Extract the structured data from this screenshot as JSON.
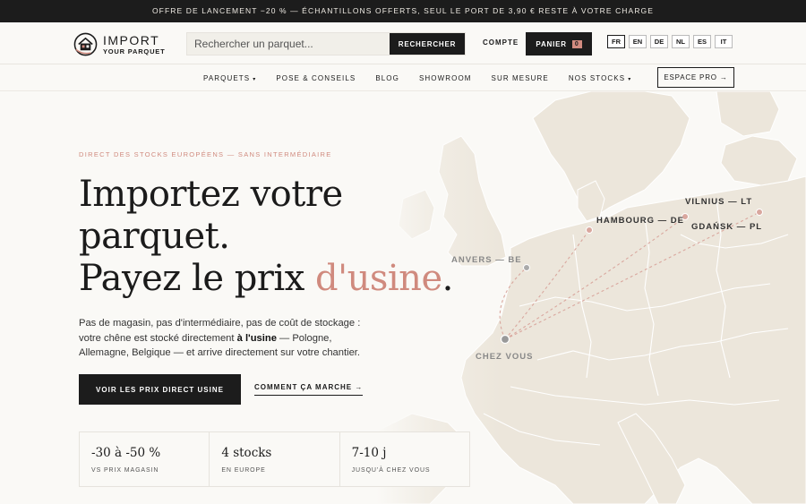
{
  "topbar": {
    "text": "OFFRE DE LANCEMENT −20 % — ÉCHANTILLONS OFFERTS, SEUL LE PORT DE 3,90 € RESTE À VOTRE CHARGE"
  },
  "header": {
    "logo_main": "IMPORT",
    "logo_sub": "YOUR PARQUET",
    "search_placeholder": "Rechercher un parquet...",
    "search_button": "RECHERCHER",
    "account": "COMPTE",
    "cart_label": "PANIER",
    "cart_count": "0",
    "languages": [
      "FR",
      "EN",
      "DE",
      "NL",
      "ES",
      "IT"
    ],
    "active_language": "FR"
  },
  "nav": {
    "items": [
      {
        "label": "PARQUETS",
        "caret": "▾"
      },
      {
        "label": "POSE & CONSEILS",
        "caret": ""
      },
      {
        "label": "BLOG",
        "caret": ""
      },
      {
        "label": "SHOWROOM",
        "caret": ""
      },
      {
        "label": "SUR MESURE",
        "caret": ""
      },
      {
        "label": "NOS STOCKS",
        "caret": "▾"
      }
    ],
    "pro_button": "ESPACE PRO →"
  },
  "hero": {
    "eyebrow": "DIRECT DES STOCKS EUROPÉENS — SANS INTERMÉDIAIRE",
    "title_line1": "Importez votre",
    "title_line2": "parquet.",
    "title_line3_pre": "Payez le prix ",
    "title_line3_accent": "d'usine",
    "title_line3_post": ".",
    "lead_pre": "Pas de magasin, pas d'intermédiaire, pas de coût de stockage : votre chêne est stocké directement ",
    "lead_strong": "à l'usine",
    "lead_post": " — Pologne, Allemagne, Belgique — et arrive directement sur votre chantier.",
    "cta_primary": "VOIR LES PRIX DIRECT USINE",
    "cta_link": "COMMENT ÇA MARCHE →"
  },
  "stats": [
    {
      "value": "-30 à -50 %",
      "label": "VS PRIX MAGASIN"
    },
    {
      "value": "4 stocks",
      "label": "EN EUROPE"
    },
    {
      "value": "7-10 j",
      "label": "JUSQU'À CHEZ VOUS"
    }
  ],
  "map": {
    "labels": {
      "antwerp": "ANVERS — BE",
      "hamburg": "HAMBOURG — DE",
      "vilnius": "VILNIUS — LT",
      "gdansk": "GDAŃSK — PL",
      "home": "CHEZ VOUS"
    },
    "colors": {
      "land": "#ece6db",
      "border": "#ffffff",
      "route": "#d9a79e",
      "accent": "#d08a7e"
    }
  }
}
